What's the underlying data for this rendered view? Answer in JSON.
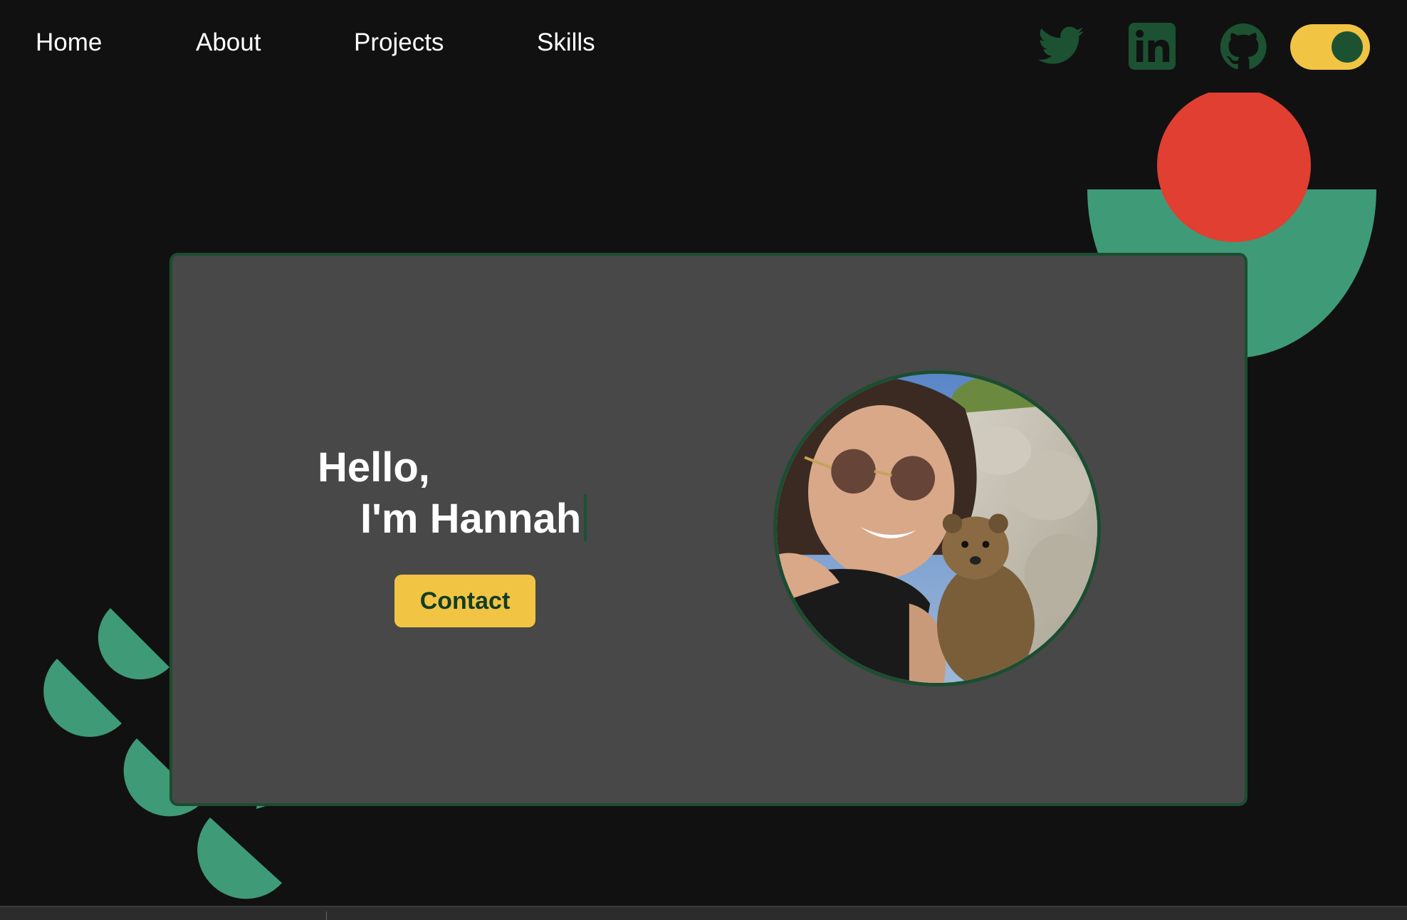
{
  "nav": {
    "items": [
      {
        "label": "Home"
      },
      {
        "label": "About"
      },
      {
        "label": "Projects"
      },
      {
        "label": "Skills"
      }
    ]
  },
  "social": {
    "icons": [
      "twitter-icon",
      "linkedin-icon",
      "github-icon"
    ],
    "icon_color": "#1c5232"
  },
  "theme_toggle": {
    "state": "on",
    "track_color": "#f2c443",
    "knob_color": "#1c5232"
  },
  "hero": {
    "greeting_line1": "Hello,",
    "greeting_line2": "I'm Hannah",
    "contact_label": "Contact"
  },
  "colors": {
    "background": "#111111",
    "card": "#484848",
    "card_border": "#1c4d30",
    "accent_yellow": "#f2c443",
    "accent_green": "#3f9a78",
    "accent_red": "#e13f31",
    "dark_green": "#1c5232"
  }
}
